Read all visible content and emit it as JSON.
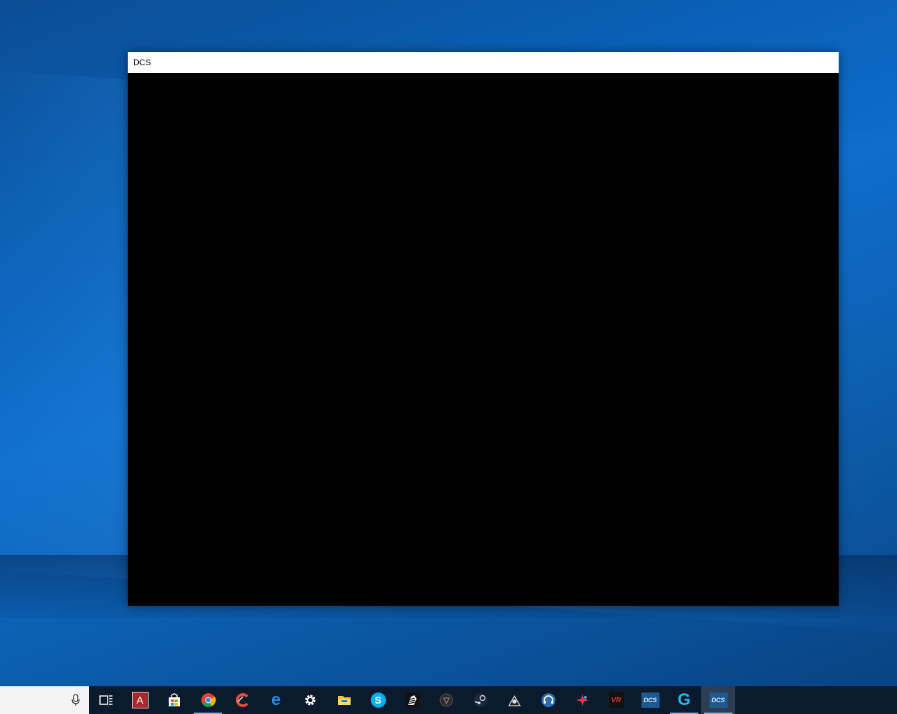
{
  "window": {
    "title": "DCS"
  },
  "taskbar": {
    "search_placeholder": "",
    "items": [
      {
        "name": "task-view-icon",
        "label": ""
      },
      {
        "name": "app-a-icon",
        "label": "A"
      },
      {
        "name": "microsoft-store-icon",
        "label": ""
      },
      {
        "name": "chrome-icon",
        "label": ""
      },
      {
        "name": "ccleaner-icon",
        "label": ""
      },
      {
        "name": "edge-icon",
        "label": "e"
      },
      {
        "name": "settings-gear-icon",
        "label": ""
      },
      {
        "name": "file-explorer-icon",
        "label": ""
      },
      {
        "name": "skype-icon",
        "label": "S"
      },
      {
        "name": "zebra-app-icon",
        "label": ""
      },
      {
        "name": "dark-circle-app-icon",
        "label": ""
      },
      {
        "name": "steam-icon",
        "label": ""
      },
      {
        "name": "speaker-app-icon",
        "label": ""
      },
      {
        "name": "headset-app-icon",
        "label": ""
      },
      {
        "name": "red-star-app-icon",
        "label": ""
      },
      {
        "name": "vr-app-icon",
        "label": "VR"
      },
      {
        "name": "dcs-app-icon",
        "label": "DCS"
      },
      {
        "name": "logitech-g-icon",
        "label": "G"
      },
      {
        "name": "dcs-window-icon",
        "label": "DCS"
      }
    ]
  },
  "colors": {
    "taskbar_bg": "#0b1a2c",
    "accent": "#79b8f2",
    "desktop_blue": "#0a5fb4"
  }
}
